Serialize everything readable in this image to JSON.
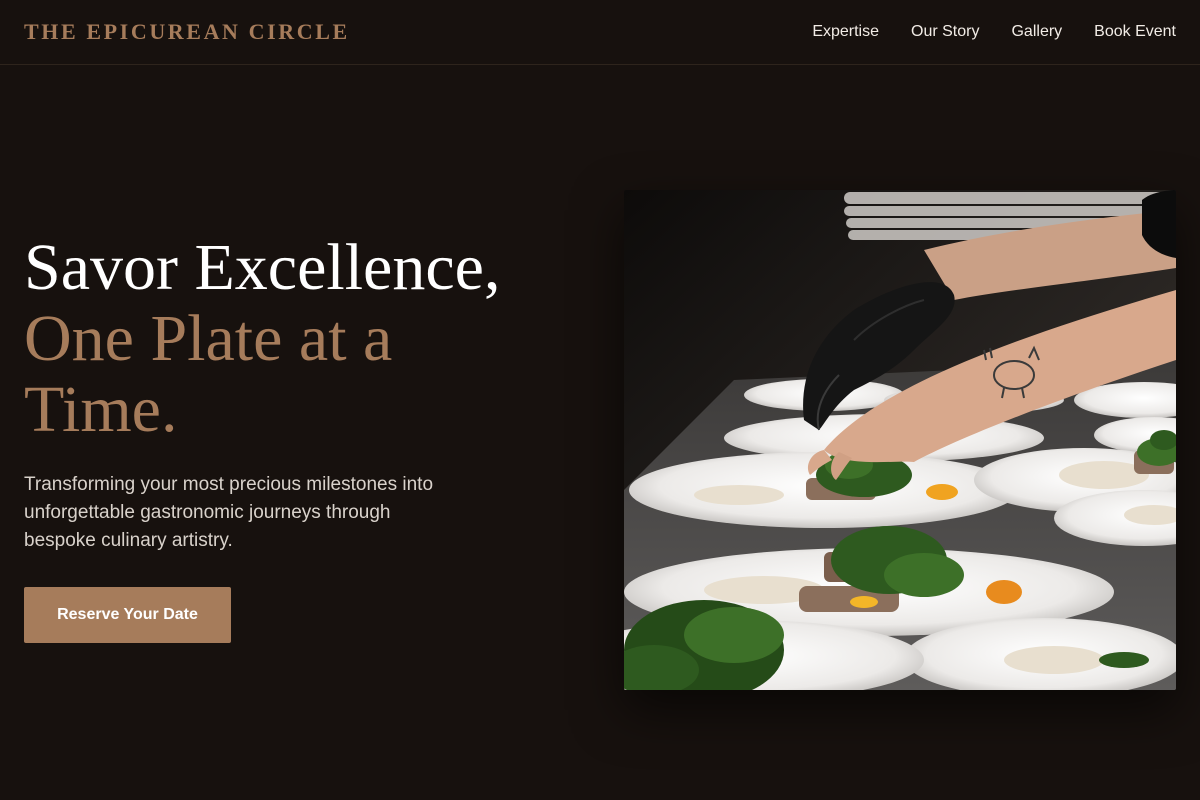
{
  "header": {
    "brand": "THE EPICUREAN CIRCLE",
    "nav": [
      {
        "label": "Expertise"
      },
      {
        "label": "Our Story"
      },
      {
        "label": "Gallery"
      },
      {
        "label": "Book Event"
      }
    ]
  },
  "hero": {
    "headline_line1": "Savor Excellence,",
    "headline_line2": "One Plate at a Time.",
    "subtitle": "Transforming your most precious milestones into unforgettable gastronomic journeys through bespoke culinary artistry.",
    "cta_label": "Reserve Your Date",
    "photo_alt": "Chef plating dishes"
  },
  "colors": {
    "background": "#17110e",
    "accent": "#a67c5b",
    "text": "#ffffff",
    "muted_text": "#d9d2cb"
  }
}
